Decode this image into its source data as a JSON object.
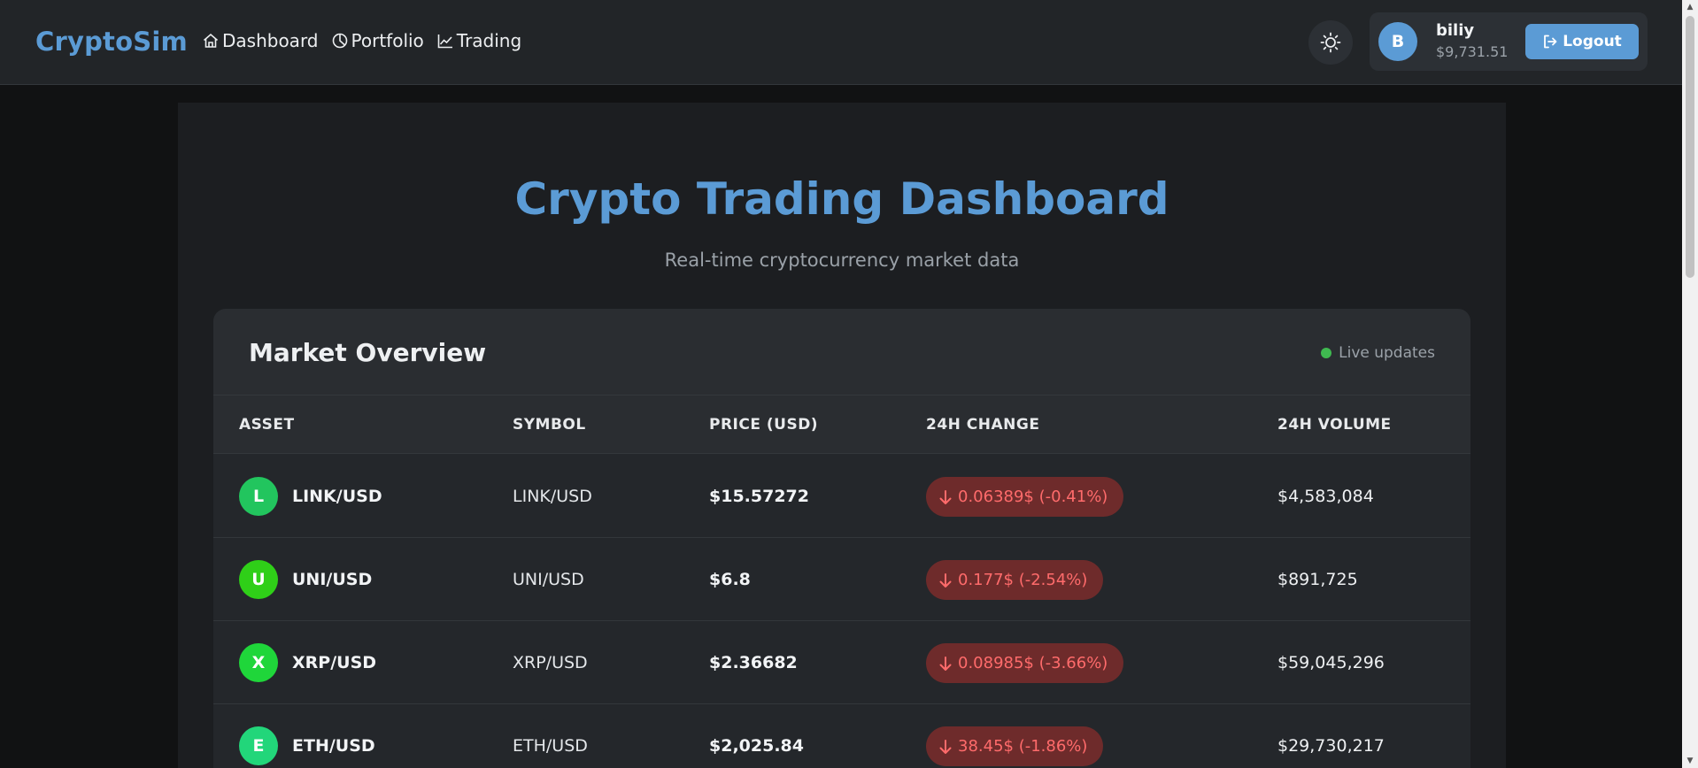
{
  "brand": "CryptoSim",
  "nav": {
    "items": [
      {
        "label": "Dashboard",
        "icon": "home-icon"
      },
      {
        "label": "Portfolio",
        "icon": "pie-chart-icon"
      },
      {
        "label": "Trading",
        "icon": "trend-line-icon"
      }
    ]
  },
  "theme_toggle": {
    "icon": "sun-icon"
  },
  "user": {
    "avatar_initial": "B",
    "name": "biliy",
    "balance": "$9,731.51",
    "logout_label": "Logout"
  },
  "page": {
    "title": "Crypto Trading Dashboard",
    "subtitle": "Real-time cryptocurrency market data"
  },
  "market": {
    "title": "Market Overview",
    "live_label": "Live updates",
    "columns": [
      "ASSET",
      "SYMBOL",
      "PRICE (USD)",
      "24H CHANGE",
      "24H VOLUME"
    ],
    "rows": [
      {
        "initial": "L",
        "asset": "LINK/USD",
        "symbol": "LINK/USD",
        "price": "$15.57272",
        "change": "0.06389$ (-0.41%)",
        "volume": "$4,583,084",
        "color": "#22c55e"
      },
      {
        "initial": "U",
        "asset": "UNI/USD",
        "symbol": "UNI/USD",
        "price": "$6.8",
        "change": "0.177$ (-2.54%)",
        "volume": "$891,725",
        "color": "#2fcf18"
      },
      {
        "initial": "X",
        "asset": "XRP/USD",
        "symbol": "XRP/USD",
        "price": "$2.36682",
        "change": "0.08985$ (-3.66%)",
        "volume": "$59,045,296",
        "color": "#1fd63a"
      },
      {
        "initial": "E",
        "asset": "ETH/USD",
        "symbol": "ETH/USD",
        "price": "$2,025.84",
        "change": "38.45$ (-1.86%)",
        "volume": "$29,730,217",
        "color": "#22d67a"
      }
    ]
  },
  "colors": {
    "accent": "#5b9bd5",
    "negative": "#ff6b6b",
    "live": "#3fb950"
  }
}
